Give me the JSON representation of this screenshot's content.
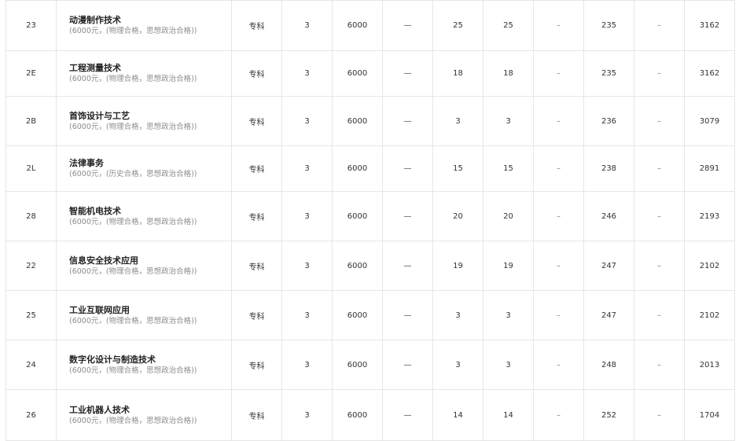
{
  "rows": [
    {
      "code": "23",
      "name": "动漫制作技术",
      "note": "(6000元，(物理合格，思想政治合格))",
      "level": "专科",
      "years": "3",
      "fee": "6000",
      "c1": "—",
      "c2": "25",
      "c3": "25",
      "c4": "–",
      "c5": "235",
      "c6": "–",
      "rank": "3162"
    },
    {
      "code": "2E",
      "name": "工程测量技术",
      "note": "(6000元，(物理合格，思想政治合格))",
      "level": "专科",
      "years": "3",
      "fee": "6000",
      "c1": "—",
      "c2": "18",
      "c3": "18",
      "c4": "–",
      "c5": "235",
      "c6": "–",
      "rank": "3162"
    },
    {
      "code": "2B",
      "name": "首饰设计与工艺",
      "note": "(6000元，(物理合格，思想政治合格))",
      "level": "专科",
      "years": "3",
      "fee": "6000",
      "c1": "—",
      "c2": "3",
      "c3": "3",
      "c4": "–",
      "c5": "236",
      "c6": "–",
      "rank": "3079"
    },
    {
      "code": "2L",
      "name": "法律事务",
      "note": "(6000元，(历史合格，思想政治合格))",
      "level": "专科",
      "years": "3",
      "fee": "6000",
      "c1": "—",
      "c2": "15",
      "c3": "15",
      "c4": "–",
      "c5": "238",
      "c6": "–",
      "rank": "2891"
    },
    {
      "code": "28",
      "name": "智能机电技术",
      "note": "(6000元，(物理合格，思想政治合格))",
      "level": "专科",
      "years": "3",
      "fee": "6000",
      "c1": "—",
      "c2": "20",
      "c3": "20",
      "c4": "–",
      "c5": "246",
      "c6": "–",
      "rank": "2193"
    },
    {
      "code": "22",
      "name": "信息安全技术应用",
      "note": "(6000元，(物理合格，思想政治合格))",
      "level": "专科",
      "years": "3",
      "fee": "6000",
      "c1": "—",
      "c2": "19",
      "c3": "19",
      "c4": "–",
      "c5": "247",
      "c6": "–",
      "rank": "2102"
    },
    {
      "code": "25",
      "name": "工业互联网应用",
      "note": "(6000元，(物理合格，思想政治合格))",
      "level": "专科",
      "years": "3",
      "fee": "6000",
      "c1": "—",
      "c2": "3",
      "c3": "3",
      "c4": "–",
      "c5": "247",
      "c6": "–",
      "rank": "2102"
    },
    {
      "code": "24",
      "name": "数字化设计与制造技术",
      "note": "(6000元，(物理合格，思想政治合格))",
      "level": "专科",
      "years": "3",
      "fee": "6000",
      "c1": "—",
      "c2": "3",
      "c3": "3",
      "c4": "–",
      "c5": "248",
      "c6": "–",
      "rank": "2013"
    },
    {
      "code": "26",
      "name": "工业机器人技术",
      "note": "(6000元，(物理合格，思想政治合格))",
      "level": "专科",
      "years": "3",
      "fee": "6000",
      "c1": "—",
      "c2": "14",
      "c3": "14",
      "c4": "–",
      "c5": "252",
      "c6": "–",
      "rank": "1704"
    }
  ]
}
